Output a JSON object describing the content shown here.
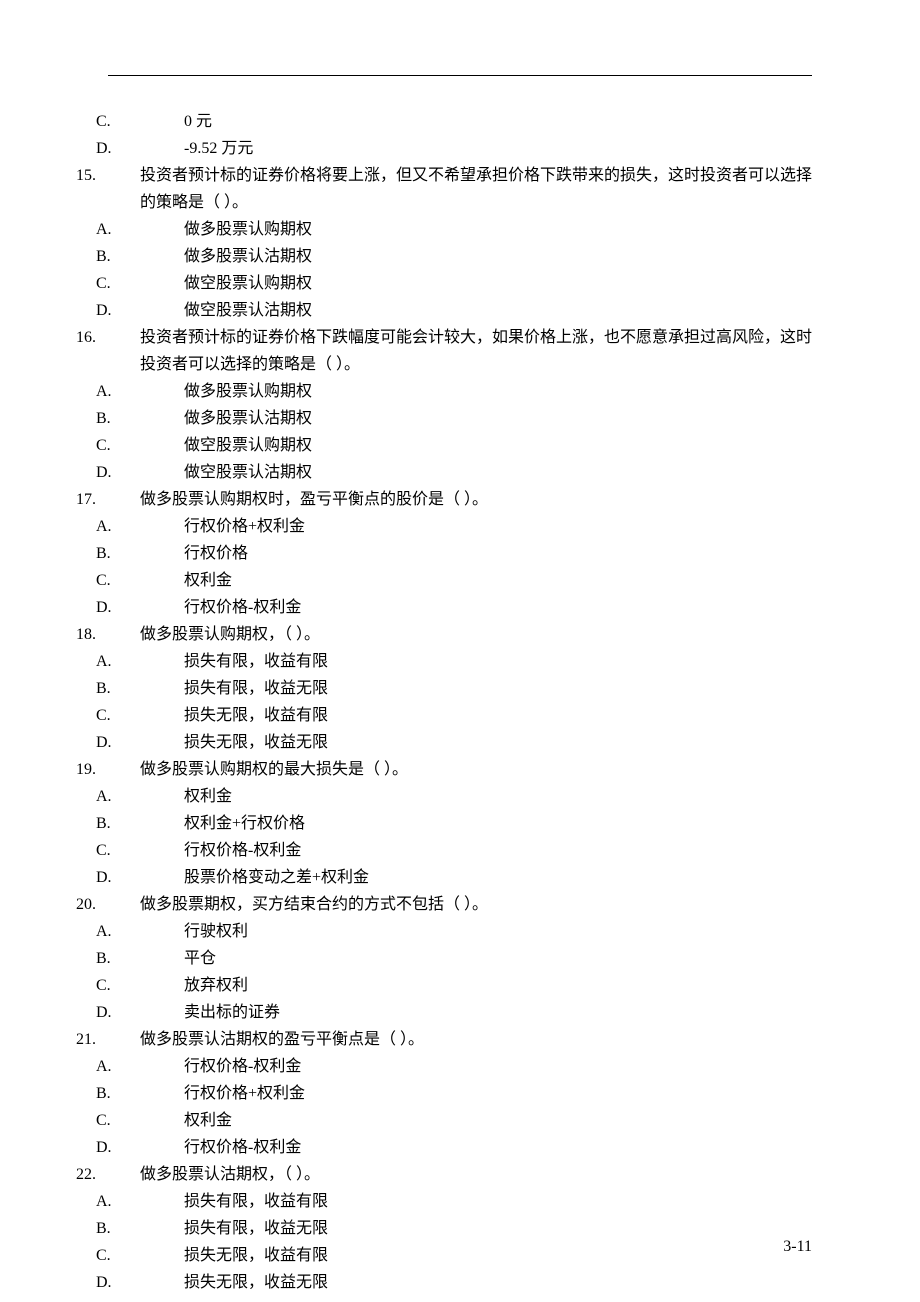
{
  "leading_options": [
    {
      "marker": "C.",
      "text": "0 元"
    },
    {
      "marker": "D.",
      "text": "-9.52 万元"
    }
  ],
  "questions": [
    {
      "num": "15.",
      "stem": "投资者预计标的证券价格将要上涨，但又不希望承担价格下跌带来的损失，这时投资者可以选择的策略是（ ）。",
      "options": [
        {
          "marker": "A.",
          "text": "做多股票认购期权"
        },
        {
          "marker": "B.",
          "text": "做多股票认沽期权"
        },
        {
          "marker": "C.",
          "text": "做空股票认购期权"
        },
        {
          "marker": "D.",
          "text": "做空股票认沽期权"
        }
      ]
    },
    {
      "num": "16.",
      "stem": "投资者预计标的证券价格下跌幅度可能会计较大，如果价格上涨，也不愿意承担过高风险，这时投资者可以选择的策略是（ ）。",
      "options": [
        {
          "marker": "A.",
          "text": "做多股票认购期权"
        },
        {
          "marker": "B.",
          "text": "做多股票认沽期权"
        },
        {
          "marker": "C.",
          "text": "做空股票认购期权"
        },
        {
          "marker": "D.",
          "text": "做空股票认沽期权"
        }
      ]
    },
    {
      "num": "17.",
      "stem": "做多股票认购期权时，盈亏平衡点的股价是（ ）。",
      "options": [
        {
          "marker": "A.",
          "text": "行权价格+权利金"
        },
        {
          "marker": "B.",
          "text": "行权价格"
        },
        {
          "marker": "C.",
          "text": "权利金"
        },
        {
          "marker": "D.",
          "text": "行权价格-权利金"
        }
      ]
    },
    {
      "num": "18.",
      "stem": "做多股票认购期权，（ ）。",
      "options": [
        {
          "marker": "A.",
          "text": "损失有限，收益有限"
        },
        {
          "marker": "B.",
          "text": "损失有限，收益无限"
        },
        {
          "marker": "C.",
          "text": "损失无限，收益有限"
        },
        {
          "marker": "D.",
          "text": "损失无限，收益无限"
        }
      ]
    },
    {
      "num": "19.",
      "stem": "做多股票认购期权的最大损失是（ ）。",
      "options": [
        {
          "marker": "A.",
          "text": "权利金"
        },
        {
          "marker": "B.",
          "text": "权利金+行权价格"
        },
        {
          "marker": "C.",
          "text": "行权价格-权利金"
        },
        {
          "marker": "D.",
          "text": "股票价格变动之差+权利金"
        }
      ]
    },
    {
      "num": "20.",
      "stem": "做多股票期权，买方结束合约的方式不包括（ ）。",
      "options": [
        {
          "marker": "A.",
          "text": "行驶权利"
        },
        {
          "marker": "B.",
          "text": "平仓"
        },
        {
          "marker": "C.",
          "text": "放弃权利"
        },
        {
          "marker": "D.",
          "text": "卖出标的证券"
        }
      ]
    },
    {
      "num": "21.",
      "stem": "做多股票认沽期权的盈亏平衡点是（ ）。",
      "options": [
        {
          "marker": "A.",
          "text": "行权价格-权利金"
        },
        {
          "marker": "B.",
          "text": "行权价格+权利金"
        },
        {
          "marker": "C.",
          "text": "权利金"
        },
        {
          "marker": "D.",
          "text": "行权价格-权利金"
        }
      ]
    },
    {
      "num": "22.",
      "stem": "做多股票认沽期权，（ ）。",
      "options": [
        {
          "marker": "A.",
          "text": "损失有限，收益有限"
        },
        {
          "marker": "B.",
          "text": "损失有限，收益无限"
        },
        {
          "marker": "C.",
          "text": "损失无限，收益有限"
        },
        {
          "marker": "D.",
          "text": "损失无限，收益无限"
        }
      ]
    }
  ],
  "page_number": "3-11"
}
